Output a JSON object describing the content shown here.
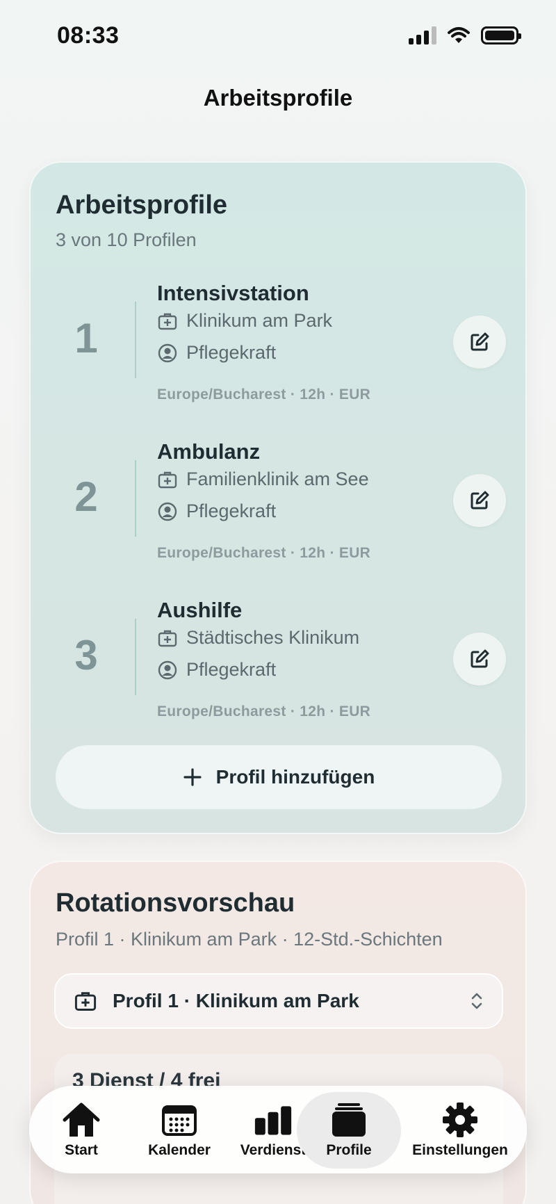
{
  "status": {
    "time": "08:33"
  },
  "nav": {
    "title": "Arbeitsprofile"
  },
  "profiles_card": {
    "title": "Arbeitsprofile",
    "subtitle": "3 von 10 Profilen",
    "profiles": [
      {
        "number": "1",
        "name": "Intensivstation",
        "clinic": "Klinikum am Park",
        "role": "Pflegekraft",
        "meta": "Europe/Bucharest · 12h · EUR"
      },
      {
        "number": "2",
        "name": "Ambulanz",
        "clinic": "Familienklinik am See",
        "role": "Pflegekraft",
        "meta": "Europe/Bucharest · 12h · EUR"
      },
      {
        "number": "3",
        "name": "Aushilfe",
        "clinic": "Städtisches Klinikum",
        "role": "Pflegekraft",
        "meta": "Europe/Bucharest · 12h · EUR"
      }
    ],
    "add_label": "Profil hinzufügen"
  },
  "rotation_card": {
    "title": "Rotationsvorschau",
    "subtitle": "Profil 1 · Klinikum am Park · 12-Std.-Schichten",
    "select_value": "Profil 1 · Klinikum am Park",
    "preview_title": "3 Dienst / 4 frei"
  },
  "tabs": [
    {
      "label": "Start",
      "icon": "house-icon"
    },
    {
      "label": "Kalender",
      "icon": "calendar-icon"
    },
    {
      "label": "Verdienst",
      "icon": "bar-chart-icon"
    },
    {
      "label": "Profile",
      "icon": "stack-icon",
      "active": true
    },
    {
      "label": "Einstellungen",
      "icon": "gear-icon"
    }
  ]
}
